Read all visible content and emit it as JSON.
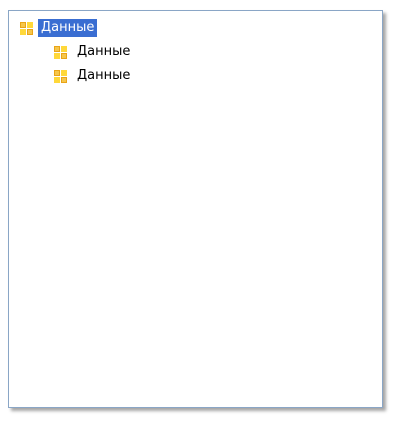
{
  "tree": {
    "root": {
      "label": "Данные",
      "icon": "grid-icon",
      "selected": true
    },
    "children": [
      {
        "label": "Данные",
        "icon": "grid-icon"
      },
      {
        "label": "Данные",
        "icon": "grid-icon"
      }
    ]
  },
  "colors": {
    "selection_bg": "#3a6ed2",
    "icon_orange": "#e9a417",
    "icon_yellow": "#ffd83a",
    "border": "#8aa6c6"
  }
}
